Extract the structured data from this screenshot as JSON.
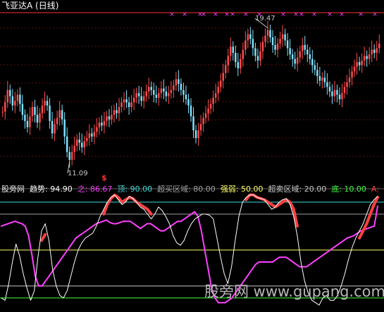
{
  "header": {
    "title": "飞亚达A (日线)"
  },
  "price_panel": {
    "high_label": "19.47",
    "low_label": "11.09",
    "signal_glyph": "$",
    "top_ref_line_color": "#ff3030",
    "bar_up_color": "#ff4d4d",
    "bar_down_color": "#7fe3ff",
    "marker_color": "#ff40ff"
  },
  "indicator_legend": [
    {
      "name": "股旁网",
      "value": "",
      "color": "#e8e8e8"
    },
    {
      "name": "趋势:",
      "value": "94.90",
      "color": "#ffffff"
    },
    {
      "name": "之:",
      "value": "86.67",
      "color": "#ff40ff"
    },
    {
      "name": "顶:",
      "value": "90.00",
      "color": "#3ddcdc"
    },
    {
      "name": "超买区域:",
      "value": "80.00",
      "color": "#a0a0a0"
    },
    {
      "name": "强弱:",
      "value": "50.00",
      "color": "#ffff66"
    },
    {
      "name": "超卖区域:",
      "value": "20.00",
      "color": "#c8c8c8"
    },
    {
      "name": "底:",
      "value": "10.00",
      "color": "#40ff40"
    },
    {
      "name": "A:",
      "value": "",
      "color": "#ff4040"
    }
  ],
  "watermark": "股旁网 www.gupang.com",
  "chart_data": [
    {
      "type": "candlestick",
      "title": "飞亚达A (日线)",
      "annotations": [
        {
          "label": "19.47",
          "kind": "high"
        },
        {
          "label": "11.09",
          "kind": "low"
        }
      ],
      "ylim": [
        10.5,
        20.5
      ],
      "closes": [
        14.2,
        14.8,
        15.6,
        15.2,
        14.6,
        14.9,
        15.3,
        14.7,
        14.0,
        13.6,
        13.2,
        13.9,
        14.5,
        14.0,
        13.5,
        14.1,
        14.6,
        14.9,
        14.6,
        13.6,
        12.8,
        13.4,
        13.8,
        14.3,
        13.7,
        12.6,
        11.6,
        11.09,
        11.6,
        12.0,
        12.4,
        12.2,
        11.9,
        12.3,
        12.5,
        12.8,
        12.6,
        12.9,
        13.2,
        13.5,
        13.3,
        13.6,
        13.9,
        13.7,
        14.0,
        14.3,
        14.1,
        14.5,
        14.8,
        15.0,
        14.8,
        14.5,
        14.8,
        15.1,
        15.4,
        15.2,
        14.9,
        15.2,
        15.5,
        15.8,
        15.6,
        15.3,
        15.1,
        15.4,
        15.7,
        15.5,
        15.2,
        15.4,
        15.6,
        15.9,
        16.3,
        16.0,
        15.6,
        15.3,
        15.0,
        14.6,
        13.9,
        13.0,
        12.5,
        13.0,
        13.4,
        13.8,
        14.1,
        14.4,
        14.7,
        15.1,
        15.4,
        15.8,
        16.2,
        16.7,
        17.2,
        17.8,
        18.4,
        18.0,
        17.4,
        17.0,
        17.6,
        18.2,
        18.8,
        19.2,
        18.9,
        18.3,
        17.8,
        17.5,
        18.1,
        18.7,
        19.1,
        19.47,
        19.0,
        18.5,
        18.2,
        18.6,
        18.9,
        19.2,
        18.8,
        18.3,
        17.9,
        17.6,
        17.3,
        17.7,
        18.1,
        18.5,
        18.2,
        17.9,
        17.6,
        17.2,
        16.9,
        16.5,
        16.2,
        16.4,
        16.1,
        15.8,
        15.5,
        15.2,
        15.6,
        15.3,
        15.0,
        15.4,
        15.8,
        16.1,
        16.4,
        16.8,
        17.1,
        17.4,
        17.2,
        17.5,
        17.8,
        17.6,
        17.9,
        18.2,
        18.0,
        18.3,
        18.6
      ],
      "x_markers_count": 14
    },
    {
      "type": "line",
      "title": "",
      "levels": [
        {
          "name": "顶",
          "value": 90.0,
          "color": "#3ddcdc"
        },
        {
          "name": "超买区域",
          "value": 80.0,
          "color": "#a0a0a0"
        },
        {
          "name": "强弱",
          "value": 50.0,
          "color": "#ffff66"
        },
        {
          "name": "超卖区域",
          "value": 20.0,
          "color": "#c8c8c8"
        },
        {
          "name": "底",
          "value": 10.0,
          "color": "#40ff40"
        }
      ],
      "ylim": [
        0,
        100
      ],
      "series": [
        {
          "name": "趋势",
          "color": "#ffffff",
          "values": [
            10,
            8,
            22,
            40,
            55,
            45,
            30,
            18,
            8,
            16,
            44,
            66,
            72,
            58,
            34,
            20,
            12,
            10,
            16,
            28,
            40,
            50,
            56,
            60,
            62,
            64,
            70,
            78,
            84,
            90,
            94,
            96,
            92,
            88,
            90,
            95,
            93,
            90,
            86,
            84,
            80,
            76,
            80,
            86,
            83,
            78,
            72,
            62,
            56,
            54,
            58,
            66,
            72,
            76,
            78,
            80,
            80,
            79,
            76,
            60,
            44,
            30,
            22,
            36,
            58,
            78,
            90,
            94,
            96,
            96,
            94,
            93,
            92,
            88,
            84,
            86,
            90,
            92,
            93,
            88,
            78,
            62,
            40,
            24,
            14,
            8,
            6,
            4,
            10,
            12,
            8,
            8,
            12,
            20,
            30,
            42,
            52,
            60,
            66,
            72,
            80,
            88,
            92,
            94.9
          ]
        },
        {
          "name": "之",
          "color": "#ff40ff",
          "values": [
            70,
            71,
            72,
            73,
            74,
            73,
            72,
            70,
            62,
            46,
            28,
            20,
            20,
            24,
            28,
            32,
            36,
            40,
            44,
            48,
            52,
            56,
            60,
            62,
            64,
            66,
            68,
            70,
            72,
            73,
            74,
            75,
            73,
            72,
            72,
            73,
            74,
            74,
            74,
            72,
            70,
            68,
            70,
            72,
            72,
            70,
            68,
            66,
            66,
            68,
            70,
            72,
            74,
            74,
            76,
            78,
            80,
            82,
            78,
            66,
            50,
            34,
            18,
            10,
            6,
            6,
            6,
            8,
            10,
            14,
            18,
            22,
            26,
            30,
            34,
            38,
            40,
            40,
            40,
            40,
            40,
            42,
            44,
            44,
            44,
            42,
            40,
            38,
            36,
            36,
            36,
            38,
            40,
            42,
            44,
            46,
            48,
            50,
            52,
            54,
            56,
            58,
            60,
            61,
            62,
            64,
            66,
            67,
            68,
            69,
            70,
            86.67
          ]
        },
        {
          "name": "A",
          "color": "#ff4040",
          "values": [
            null,
            null,
            null,
            null,
            null,
            null,
            null,
            null,
            null,
            null,
            null,
            58,
            63,
            null,
            null,
            null,
            null,
            null,
            null,
            null,
            null,
            null,
            null,
            null,
            null,
            null,
            null,
            null,
            80,
            88,
            93,
            96,
            94,
            90,
            92,
            94,
            93,
            90,
            88,
            86,
            84,
            80,
            null,
            null,
            null,
            null,
            null,
            null,
            null,
            null,
            null,
            null,
            null,
            null,
            null,
            null,
            null,
            null,
            null,
            null,
            null,
            null,
            null,
            null,
            null,
            null,
            null,
            92,
            96,
            96,
            94,
            93,
            92,
            90,
            88,
            86,
            88,
            90,
            92,
            90,
            84,
            70,
            null,
            null,
            null,
            null,
            null,
            null,
            null,
            null,
            null,
            null,
            null,
            null,
            null,
            null,
            null,
            null,
            60,
            66,
            72,
            80,
            88,
            94
          ]
        }
      ]
    }
  ]
}
